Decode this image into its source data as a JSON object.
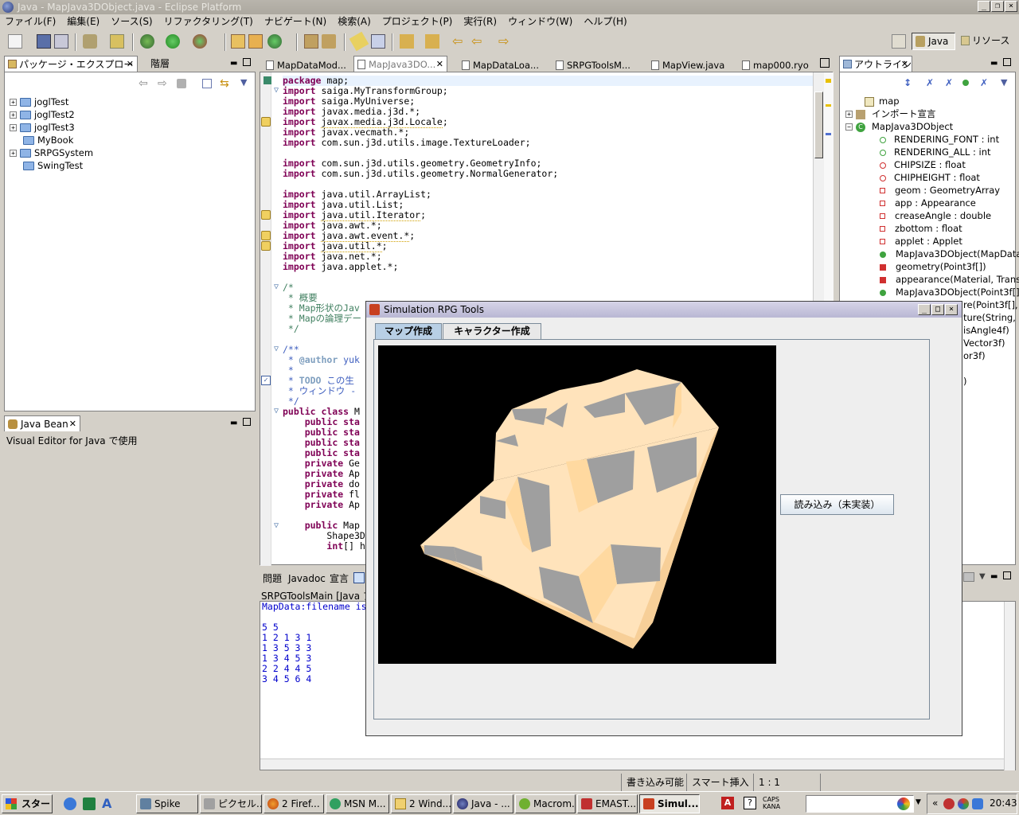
{
  "window": {
    "title": "Java - MapJava3DObject.java - Eclipse Platform"
  },
  "menu": [
    "ファイル(F)",
    "編集(E)",
    "ソース(S)",
    "リファクタリング(T)",
    "ナビゲート(N)",
    "検索(A)",
    "プロジェクト(P)",
    "実行(R)",
    "ウィンドウ(W)",
    "ヘルプ(H)"
  ],
  "perspective": {
    "java": "Java",
    "resource": "リソース"
  },
  "explorer": {
    "tabs": [
      "パッケージ・エクスプローラー",
      "階層"
    ],
    "items": [
      "joglTest",
      "joglTest2",
      "joglTest3",
      "MyBook",
      "SRPGSystem",
      "SwingTest"
    ]
  },
  "javabean": {
    "tab": "Java Bean",
    "text": "Visual Editor for Java で使用"
  },
  "editor": {
    "tabs": [
      "MapDataMod...",
      "MapJava3DO...",
      "MapDataLoa...",
      "SRPGToolsM...",
      "MapView.java",
      "map000.ryo"
    ]
  },
  "outline": {
    "tab": "アウトライン",
    "items": [
      {
        "label": "map",
        "icon": "package-icon"
      },
      {
        "label": "インポート宣言",
        "icon": "imports-icon"
      },
      {
        "label": "MapJava3DObject",
        "icon": "class-icon"
      },
      {
        "label": "RENDERING_FONT : int",
        "icon": "static-final-field-icon"
      },
      {
        "label": "RENDERING_ALL : int",
        "icon": "static-final-field-icon"
      },
      {
        "label": "CHIPSIZE : float",
        "icon": "static-final-field-icon"
      },
      {
        "label": "CHIPHEIGHT : float",
        "icon": "static-final-field-icon"
      },
      {
        "label": "geom : GeometryArray",
        "icon": "private-field-icon"
      },
      {
        "label": "app : Appearance",
        "icon": "private-field-icon"
      },
      {
        "label": "creaseAngle : double",
        "icon": "private-field-icon"
      },
      {
        "label": "zbottom : float",
        "icon": "private-field-icon"
      },
      {
        "label": "applet : Applet",
        "icon": "private-field-icon"
      },
      {
        "label": "MapJava3DObject(MapData",
        "icon": "constructor-icon"
      },
      {
        "label": "geometry(Point3f[])",
        "icon": "private-method-icon"
      },
      {
        "label": "appearance(Material, Transp",
        "icon": "private-method-icon"
      },
      {
        "label": "MapJava3DObject(Point3f[]",
        "icon": "constructor-icon"
      }
    ],
    "partial": [
      "re(Point3f[],",
      "ture(String,",
      "isAngle4f)",
      "Vector3f)",
      "or3f)",
      ")"
    ]
  },
  "console": {
    "tabs": [
      "問題",
      "Javadoc",
      "宣言"
    ],
    "header": "SRPGToolsMain [Java ア",
    "line1": "MapData:filename is",
    "data": [
      "5 5",
      "1 2 1 3 1",
      "1 3 5 3 3",
      "1 3 4 5 3",
      "2 2 4 4 5",
      "3 4 5 6 4"
    ]
  },
  "dialog": {
    "title": "Simulation RPG Tools",
    "tabs": [
      "マップ作成",
      "キャラクター作成"
    ],
    "load_button": "読み込み（未実装）"
  },
  "status": {
    "writable": "書き込み可能",
    "insert": "スマート挿入",
    "position": "1 : 1"
  },
  "taskbar": {
    "start": "スタート",
    "tasks": [
      "Spike",
      "ピクセル...",
      "2 Firef...",
      "MSN M...",
      "2 Wind...",
      "Java - ...",
      "Macrom...",
      "EMAST...",
      "Simul..."
    ],
    "clock": "20:43",
    "caps": "CAPS",
    "kana": "KANA"
  }
}
